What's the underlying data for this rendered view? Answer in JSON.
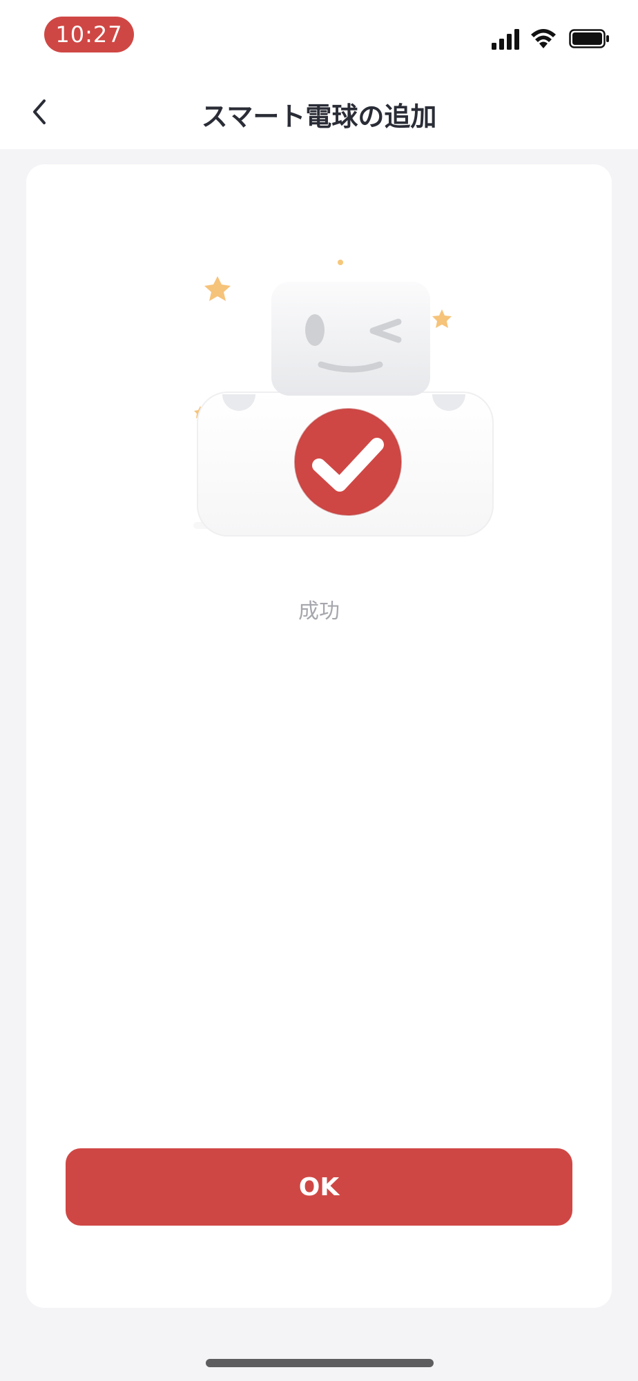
{
  "status_bar": {
    "time": "10:27",
    "icons": [
      "signal-icon",
      "wifi-icon",
      "battery-icon"
    ],
    "accent_color": "#cf4744"
  },
  "nav": {
    "title": "スマート電球の追加",
    "back_icon": "chevron-left-icon"
  },
  "result": {
    "illustration": "robot-success-illustration",
    "status_text": "成功"
  },
  "actions": {
    "ok_label": "OK",
    "button_color": "#cf4744"
  }
}
